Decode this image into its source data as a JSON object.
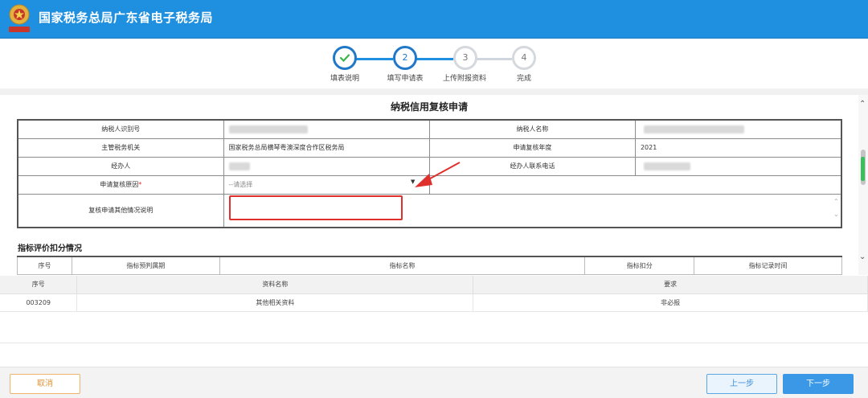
{
  "header": {
    "title": "国家税务总局广东省电子税务局",
    "emblem_text": "中国税务"
  },
  "stepper": {
    "steps": [
      {
        "number": "1",
        "label": "填表说明",
        "state": "done"
      },
      {
        "number": "2",
        "label": "填写申请表",
        "state": "active"
      },
      {
        "number": "3",
        "label": "上传附报资料",
        "state": "pending"
      },
      {
        "number": "4",
        "label": "完成",
        "state": "pending"
      }
    ]
  },
  "form": {
    "title": "纳税信用复核申请",
    "taxpayer_id_label": "纳税人识别号",
    "taxpayer_name_label": "纳税人名称",
    "tax_authority_label": "主管税务机关",
    "tax_authority_value": "国家税务总局横琴粤澳深度合作区税务局",
    "review_year_label": "申请复核年度",
    "review_year_value": "2021",
    "handler_label": "经办人",
    "handler_phone_label": "经办人联系电话",
    "reason_label": "申请复核原因",
    "reason_required": "*",
    "reason_placeholder": "--请选择",
    "other_notes_label": "复核申请其他情况说明",
    "other_notes_value": ""
  },
  "index_section": {
    "title": "指标评价扣分情况",
    "columns": [
      "序号",
      "指标预判属期",
      "指标名称",
      "指标扣分",
      "指标记录时间"
    ]
  },
  "attachments": {
    "columns": [
      "序号",
      "资料名称",
      "要求"
    ],
    "rows": [
      {
        "id": "003209",
        "name": "其他相关资料",
        "requirement": "非必报"
      }
    ]
  },
  "footer": {
    "cancel_label": "取消",
    "prev_label": "上一步",
    "next_label": "下一步"
  },
  "colors": {
    "brand_blue": "#1f8fe0",
    "highlight_red": "#e0302d",
    "cancel_orange": "#e49336"
  }
}
